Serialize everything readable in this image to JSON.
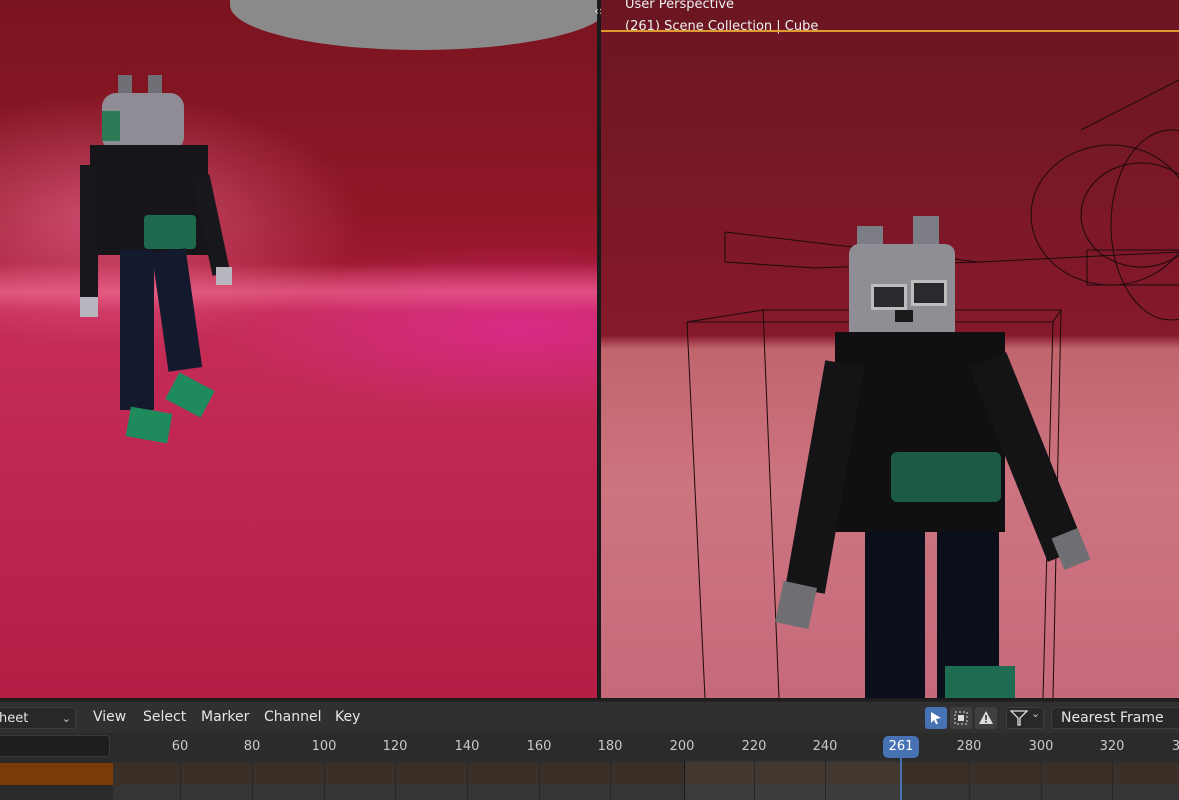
{
  "viewport_right": {
    "title": "User Perspective",
    "subtitle": "(261) Scene Collection | Cube"
  },
  "timeline": {
    "editor_type": "heet",
    "menus": [
      "View",
      "Select",
      "Marker",
      "Channel",
      "Key"
    ],
    "snap_mode": "Nearest Frame",
    "frame_ticks": [
      "60",
      "80",
      "100",
      "120",
      "140",
      "160",
      "180",
      "200",
      "220",
      "240",
      "280",
      "300",
      "320",
      "3"
    ],
    "current_frame": "261"
  },
  "icons": {
    "join": "area-join-icon",
    "select_tool": "cursor-arrow-icon",
    "box_select": "box-select-icon",
    "warning": "warning-icon",
    "filter": "filter-icon"
  },
  "colors": {
    "accent": "#4772b3",
    "timeline_line": "#e09b2f",
    "channel_orange": "#7a3b08"
  }
}
